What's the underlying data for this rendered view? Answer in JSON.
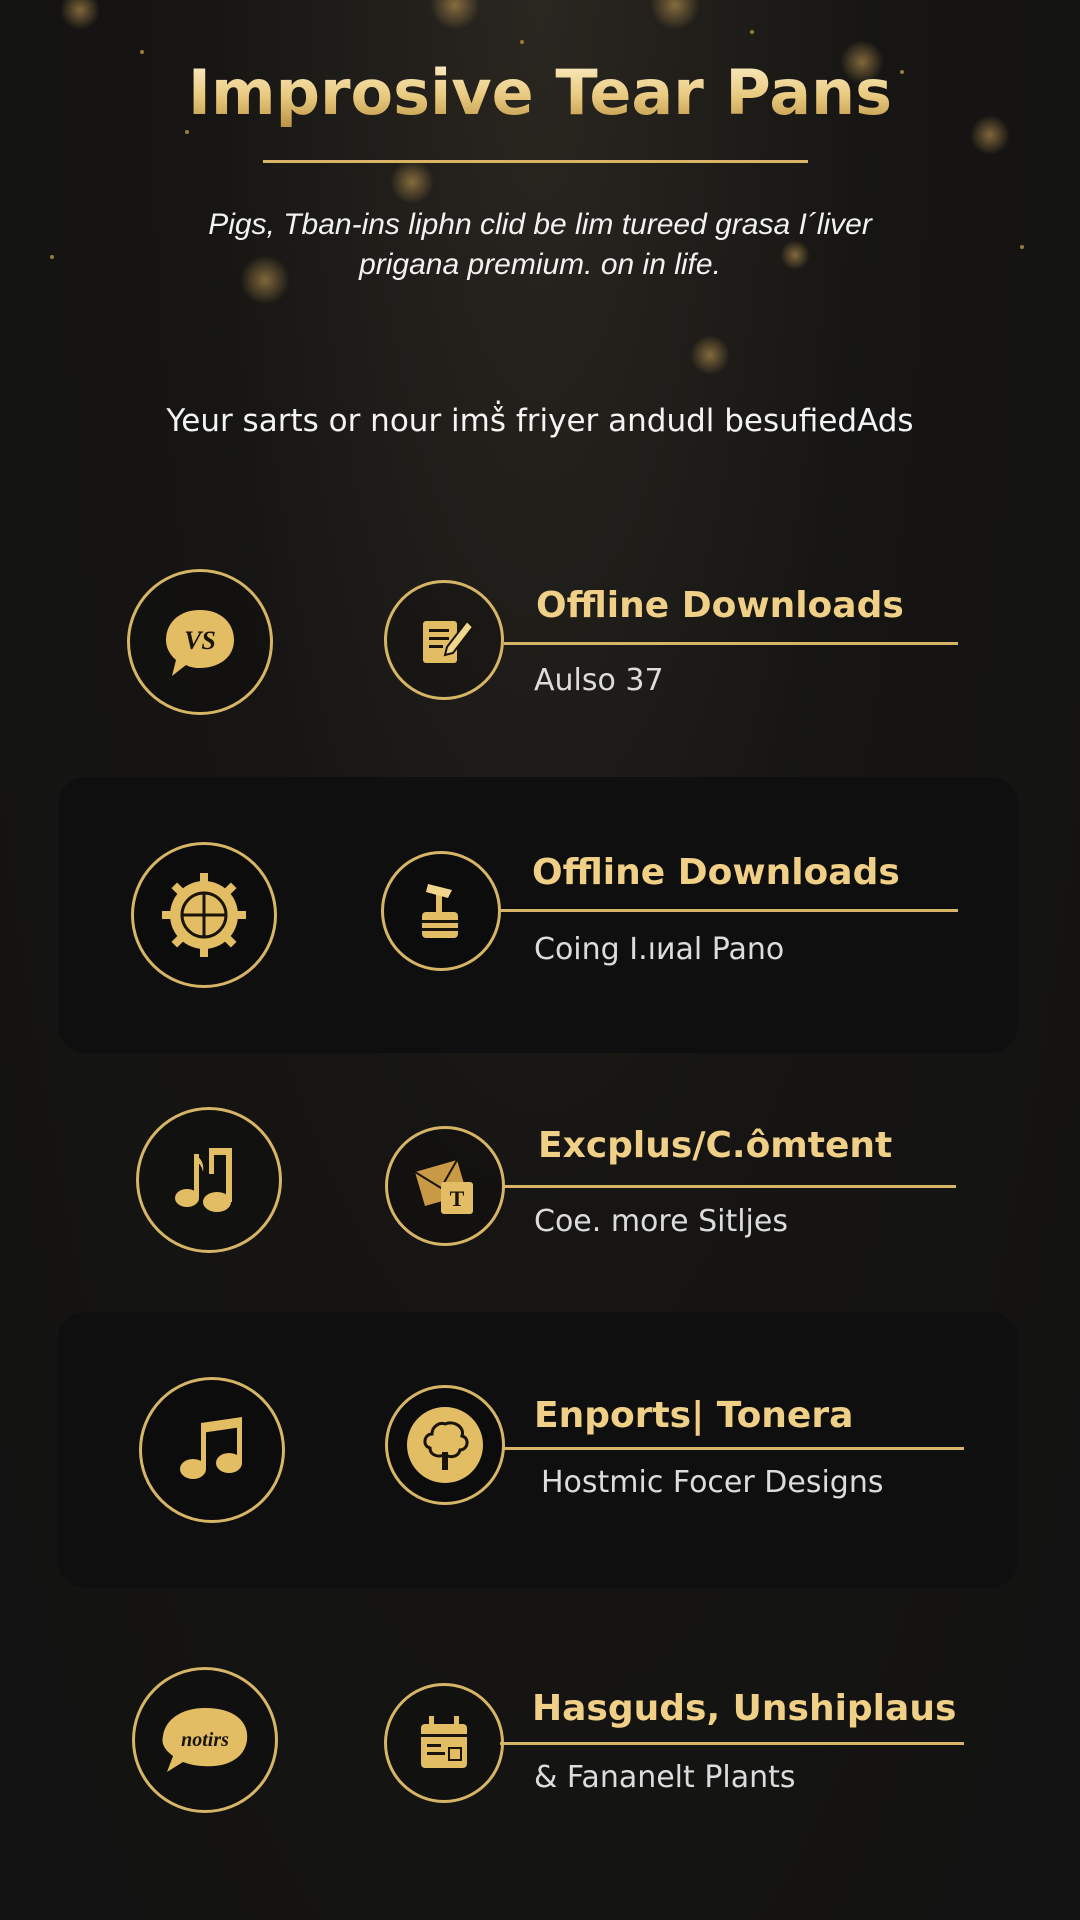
{
  "header": {
    "title": "Improsive Tear Pans",
    "subtitle_line1": "Pigs, Tban-ins liphn clid be lim tureed grasa I´liver",
    "subtitle_line2": "prigana premium. on in life.",
    "tagline": "Yeur sarts or nour imṧ friyer andudl besufiedAds"
  },
  "colors": {
    "accent": "#d7b566",
    "accent_text": "#f0cf86",
    "background": "#141414",
    "panel": "#0f0f0f"
  },
  "features": [
    {
      "left_icon": "vs-speech-bubble-icon",
      "right_icon": "document-edit-icon",
      "title": "Offline Downloads",
      "subtitle": "Aulso 37"
    },
    {
      "left_icon": "gear-seal-icon",
      "right_icon": "stamp-icon",
      "title": "Offline Downloads",
      "subtitle": "Coing I.ıиal Pano"
    },
    {
      "left_icon": "music-notes-icon",
      "right_icon": "envelope-icon",
      "title": "Excplus/C.ômtent",
      "subtitle": "Coe. more Sitljes"
    },
    {
      "left_icon": "music-note-icon",
      "right_icon": "tree-icon",
      "title": "Enports| Tonera",
      "subtitle": "Hostmic Focer Designs"
    },
    {
      "left_icon": "notes-bubble-icon",
      "right_icon": "calendar-icon",
      "title": "Hasguds, Unshiplaus",
      "subtitle": "& Fananelt Plants"
    }
  ],
  "icon_labels": {
    "vs": "VS",
    "notes": "notirs"
  }
}
